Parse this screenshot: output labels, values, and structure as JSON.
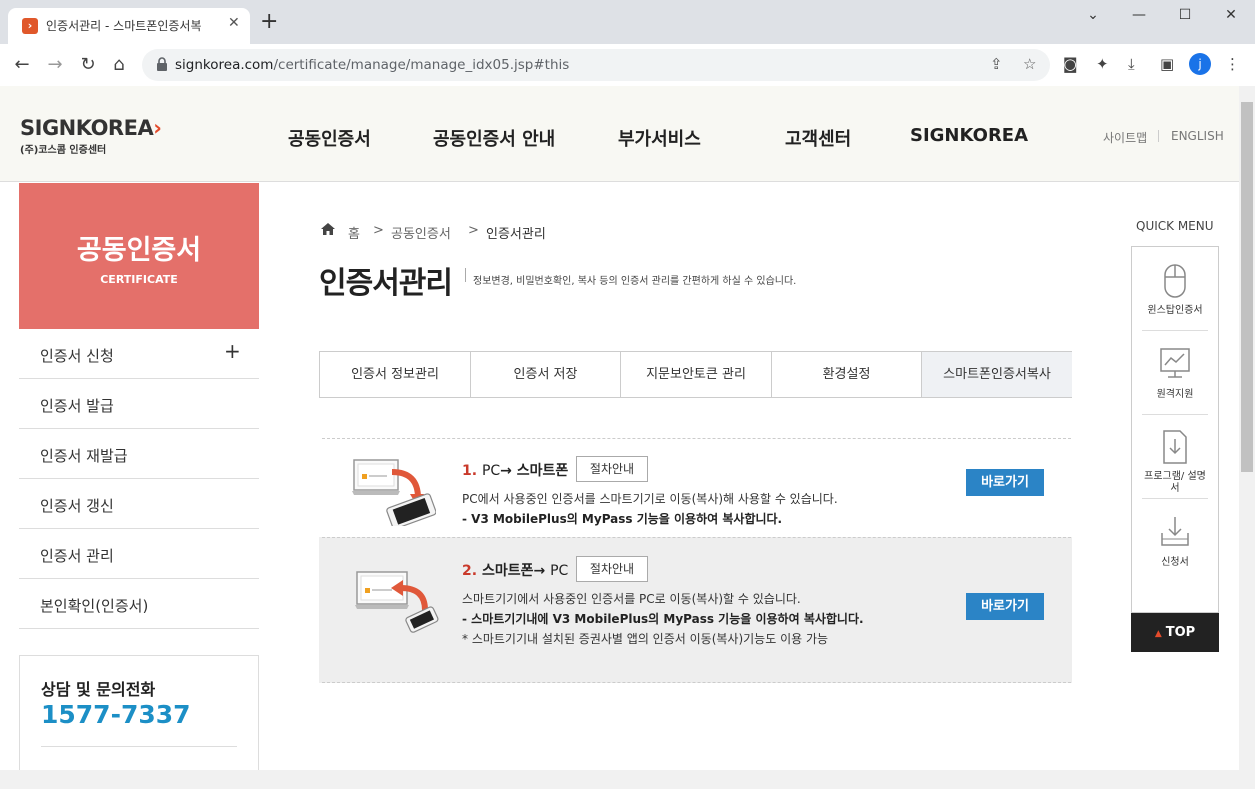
{
  "browser": {
    "tab_title": "인증서관리 - 스마트폰인증서복",
    "tab_close": "✕",
    "new_tab": "+",
    "url_host": "signkorea.com",
    "url_path": "/certificate/manage/manage_idx05.jsp#this",
    "profile_initial": "j",
    "window_controls": [
      "⌄",
      "—",
      "☐",
      "✕"
    ]
  },
  "header": {
    "logo_main": "SIGNKOREA",
    "logo_chevron": "›",
    "logo_sub": "(주)코스콤 인증센터",
    "gnb": [
      "공동인증서",
      "공동인증서 안내",
      "부가서비스",
      "고객센터",
      "SIGNKOREA"
    ],
    "util_sitemap": "사이트맵",
    "util_english": "ENGLISH"
  },
  "sidebar": {
    "hero_title": "공동인증서",
    "hero_subtitle": "CERTIFICATE",
    "items": [
      {
        "label": "인증서 신청",
        "expand": "+"
      },
      {
        "label": "인증서 발급"
      },
      {
        "label": "인증서 재발급"
      },
      {
        "label": "인증서 갱신"
      },
      {
        "label": "인증서 관리"
      },
      {
        "label": "본인확인(인증서)"
      }
    ],
    "contact_heading": "상담 및 문의전화",
    "contact_phone": "1577-7337"
  },
  "breadcrumb": {
    "home": "홈",
    "sep": ">",
    "level1": "공동인증서",
    "level2": "인증서관리"
  },
  "page": {
    "title": "인증서관리",
    "description": "정보변경, 비밀번호확인, 복사 등의 인증서 관리를 간편하게 하실 수 있습니다."
  },
  "tabs": [
    {
      "label": "인증서 정보관리",
      "active": false
    },
    {
      "label": "인증서 저장",
      "active": false
    },
    {
      "label": "지문보안토큰 관리",
      "active": false
    },
    {
      "label": "환경설정",
      "active": false
    },
    {
      "label": "스마트폰인증서복사",
      "active": true
    }
  ],
  "rows": [
    {
      "num": "1.",
      "title_from": "PC",
      "arrow": "→",
      "title_to": "스마트폰",
      "guide": "절차안내",
      "lines": [
        "PC에서 사용중인 인증서를 스마트기기로 이동(복사)해 사용할 수 있습니다.",
        "- V3 MobilePlus의 MyPass 기능을 이용하여 복사합니다."
      ],
      "go": "바로가기"
    },
    {
      "num": "2.",
      "title_from": "스마트폰",
      "arrow": "→",
      "title_to": "PC",
      "guide": "절차안내",
      "lines": [
        "스마트기기에서 사용중인 인증서를 PC로 이동(복사)할 수 있습니다.",
        "- 스마트기기내에 V3 MobilePlus의 MyPass 기능을 이용하여 복사합니다.",
        "* 스마트기기내 설치된 증권사별 앱의 인증서 이동(복사)기능도 이용 가능"
      ],
      "go": "바로가기"
    }
  ],
  "quick_menu": {
    "title": "QUICK MENU",
    "items": [
      {
        "label": "윈스탑인증서",
        "icon": "mouse-icon"
      },
      {
        "label": "원격지원",
        "icon": "monitor-chart-icon"
      },
      {
        "label": "프로그램/ 설명서",
        "icon": "document-download-icon"
      },
      {
        "label": "신청서",
        "icon": "inbox-download-icon"
      }
    ],
    "top_label": "TOP",
    "top_arrow": "▲"
  },
  "colors": {
    "accent_red": "#e4706a",
    "brand_orange": "#e44b2b",
    "button_blue": "#2b84c6",
    "phone_blue": "#1c8fc6"
  }
}
